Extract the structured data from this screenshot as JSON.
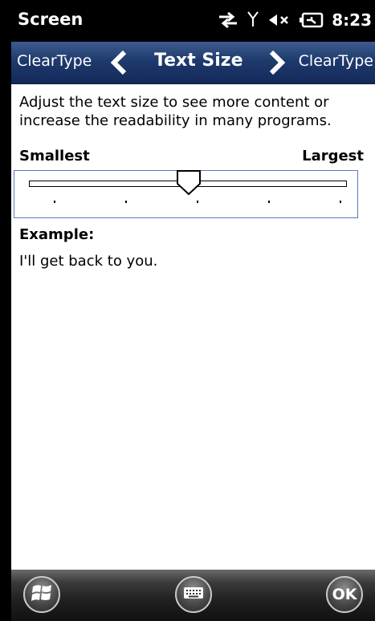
{
  "status_bar": {
    "title": "Screen",
    "time": "8:23",
    "icons": [
      "data-sync-icon",
      "signal-icon",
      "speaker-muted-icon",
      "battery-charging-icon"
    ]
  },
  "nav": {
    "prev_label": "ClearType",
    "title": "Text Size",
    "next_label": "ClearType"
  },
  "description": "Adjust the text size to see more content or increase the readability in many programs.",
  "slider": {
    "min_label": "Smallest",
    "max_label": "Largest",
    "steps": 5,
    "selected_step": 3
  },
  "example": {
    "label": "Example:",
    "text": "I'll get back to you."
  },
  "bottom_bar": {
    "ok_label": "OK",
    "icons": [
      "windows-start-icon",
      "keyboard-icon"
    ]
  },
  "colors": {
    "nav_gradient_top": "#3d5b8e",
    "nav_gradient_bottom": "#13295a",
    "slider_border": "#5a7ab8"
  }
}
